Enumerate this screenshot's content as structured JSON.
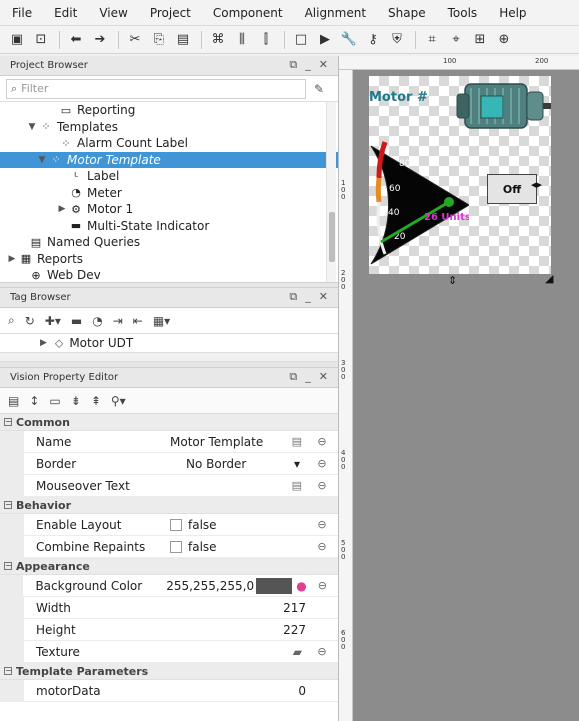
{
  "menu": [
    "File",
    "Edit",
    "View",
    "Project",
    "Component",
    "Alignment",
    "Shape",
    "Tools",
    "Help"
  ],
  "toolbar_icons": [
    "save-icon",
    "save-all-icon",
    "back-icon",
    "forward-icon",
    "cut-icon",
    "copy-icon",
    "paste-icon",
    "group-icon",
    "align-icon",
    "align-alt-icon",
    "rectangle-icon",
    "play-icon",
    "wrench-icon",
    "key-icon",
    "shield-icon",
    "grid-icon",
    "snap-icon",
    "layout-icon",
    "zoom-icon"
  ],
  "project_browser": {
    "title": "Project Browser",
    "filter_placeholder": "Filter",
    "tree": [
      {
        "label": "Reporting",
        "icon": "window-icon",
        "indent": 4,
        "twisty": ""
      },
      {
        "label": "Templates",
        "icon": "templates-icon",
        "indent": 2,
        "twisty": "▼"
      },
      {
        "label": "Alarm Count Label",
        "icon": "template-icon",
        "indent": 4,
        "twisty": ""
      },
      {
        "label": "Motor Template",
        "icon": "template-icon",
        "indent": 3,
        "twisty": "▼",
        "selected": true
      },
      {
        "label": "Label",
        "icon": "label-icon",
        "indent": 5,
        "twisty": ""
      },
      {
        "label": "Meter",
        "icon": "meter-icon",
        "indent": 5,
        "twisty": ""
      },
      {
        "label": "Motor 1",
        "icon": "motor-icon",
        "indent": 5,
        "twisty": "▶"
      },
      {
        "label": "Multi-State Indicator",
        "icon": "indicator-icon",
        "indent": 5,
        "twisty": ""
      },
      {
        "label": "Named Queries",
        "icon": "queries-icon",
        "indent": 1,
        "twisty": ""
      },
      {
        "label": "Reports",
        "icon": "reports-icon",
        "indent": 0,
        "twisty": "▶"
      },
      {
        "label": "Web Dev",
        "icon": "globe-icon",
        "indent": 1,
        "twisty": ""
      }
    ]
  },
  "tag_browser": {
    "title": "Tag Browser",
    "row": "Motor UDT"
  },
  "property_editor": {
    "title": "Vision Property Editor",
    "categories": [
      {
        "name": "Common",
        "rows": [
          {
            "name": "Name",
            "value": "Motor Template",
            "type": "text"
          },
          {
            "name": "Border",
            "value": "No Border",
            "type": "dropdown"
          },
          {
            "name": "Mouseover Text",
            "value": "",
            "type": "text"
          }
        ]
      },
      {
        "name": "Behavior",
        "rows": [
          {
            "name": "Enable Layout",
            "value": "false",
            "type": "checkbox"
          },
          {
            "name": "Combine Repaints",
            "value": "false",
            "type": "checkbox"
          }
        ]
      },
      {
        "name": "Appearance",
        "rows": [
          {
            "name": "Background Color",
            "value": "255,255,255,0",
            "type": "color"
          },
          {
            "name": "Width",
            "value": "217",
            "type": "number"
          },
          {
            "name": "Height",
            "value": "227",
            "type": "number"
          },
          {
            "name": "Texture",
            "value": "",
            "type": "image"
          }
        ]
      },
      {
        "name": "Template Parameters",
        "rows": [
          {
            "name": "motorData",
            "value": "0",
            "type": "number",
            "blue": true
          }
        ]
      }
    ]
  },
  "designer": {
    "ruler_top": [
      "100",
      "200"
    ],
    "ruler_left": [
      "100",
      "200",
      "300",
      "400",
      "500",
      "600"
    ],
    "motor_label": "Motor #",
    "off_button": "Off",
    "meter": {
      "value": 26,
      "unit_label": "26 Units",
      "ticks": [
        "20",
        "40",
        "60",
        "80"
      ]
    }
  }
}
